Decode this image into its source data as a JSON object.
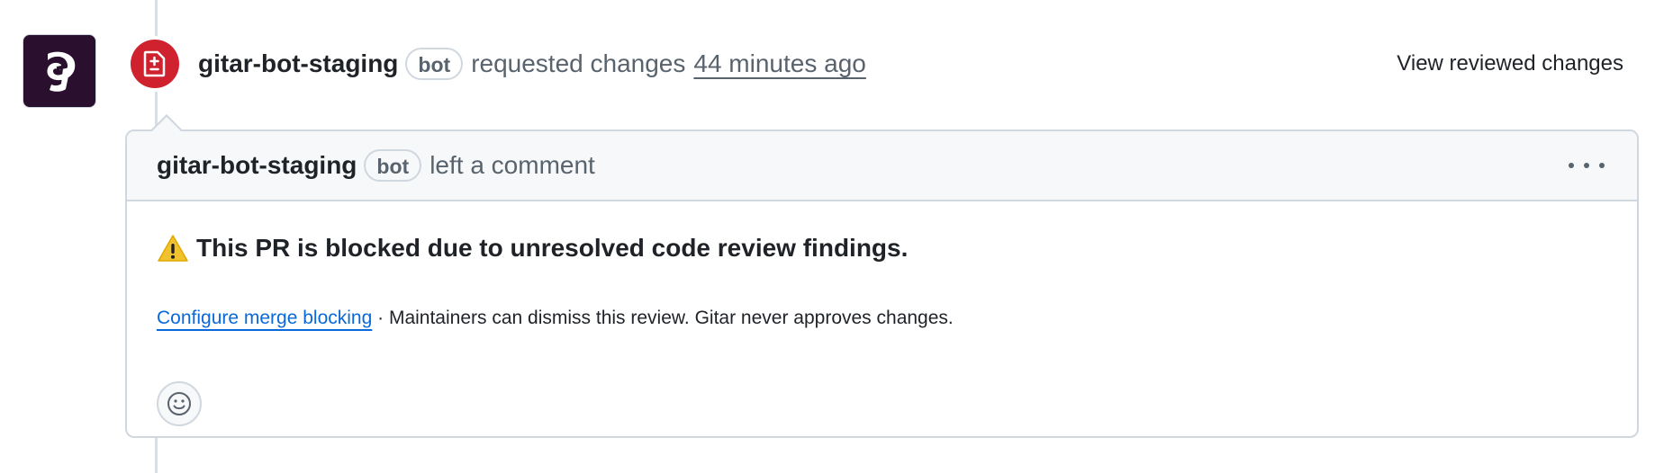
{
  "review": {
    "author": "gitar-bot-staging",
    "bot_label": "bot",
    "action": "requested changes",
    "time": "44 minutes ago",
    "view_changes_label": "View reviewed changes"
  },
  "comment": {
    "author": "gitar-bot-staging",
    "bot_label": "bot",
    "action": "left a comment",
    "headline": "This PR is blocked due to unresolved code review findings.",
    "link_text": "Configure merge blocking",
    "note": " · Maintainers can dismiss this review. Gitar never approves changes."
  },
  "icons": {
    "avatar": "gitar-logo",
    "badge": "file-diff-icon",
    "warning": "warning-icon",
    "menu": "kebab-horizontal-icon",
    "reaction": "smiley-icon"
  },
  "colors": {
    "badge_red": "#cf222e",
    "link_blue": "#0969da",
    "muted_text": "#59636e",
    "border": "#d0d7de",
    "header_bg": "#f6f8fa",
    "avatar_bg": "#2a0f2e",
    "warning_yellow": "#f2c12e"
  }
}
